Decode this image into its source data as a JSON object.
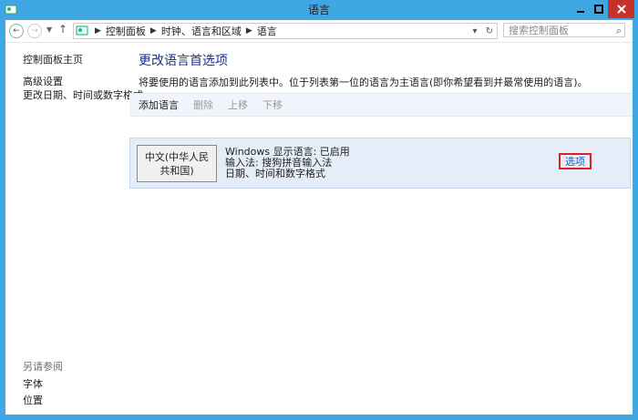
{
  "window": {
    "title": "语言"
  },
  "toolbar": {
    "breadcrumbs": [
      "控制面板",
      "时钟、语言和区域",
      "语言"
    ],
    "search_placeholder": "搜索控制面板"
  },
  "sidebar": {
    "home": "控制面板主页",
    "links": [
      "高级设置",
      "更改日期、时间或数字格式"
    ],
    "see_also_heading": "另请参阅",
    "see_also": [
      "字体",
      "位置"
    ]
  },
  "main": {
    "title": "更改语言首选项",
    "description": "将要使用的语言添加到此列表中。位于列表第一位的语言为主语言(即你希望看到并最常使用的语言)。",
    "actions": [
      "添加语言",
      "删除",
      "上移",
      "下移"
    ],
    "language": {
      "name": "中文(中华人民共和国)",
      "display_status": "Windows 显示语言: 已启用",
      "input_method": "输入法: 搜狗拼音输入法",
      "format": "日期、时间和数字格式",
      "options_link": "选项"
    }
  },
  "colors": {
    "titlebar": "#3fa7e3",
    "close": "#c7312c",
    "link": "#1e3287",
    "highlight": "#e02020"
  }
}
